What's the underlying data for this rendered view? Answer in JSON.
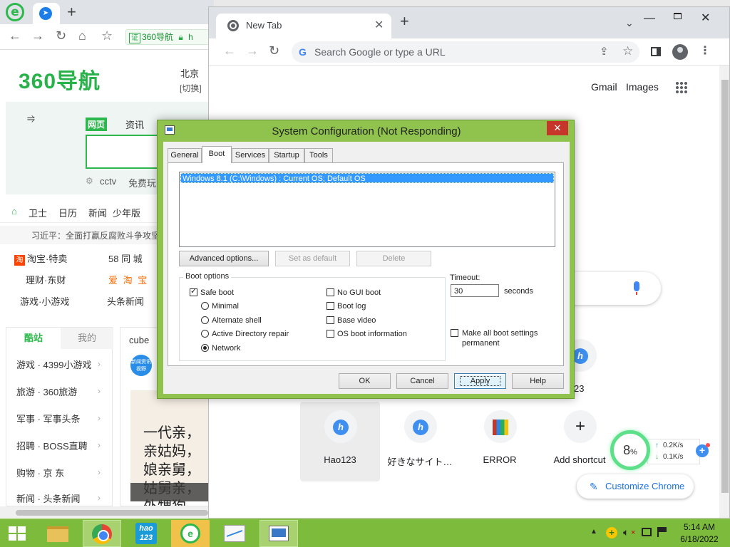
{
  "browser360": {
    "logo_letter": "e",
    "address": {
      "badge": "证",
      "text": "360导航",
      "suffix": "h"
    },
    "site": {
      "logo": "360导航",
      "city": "北京",
      "city_switch": "[切换]",
      "search_tabs": [
        "网页",
        "资讯"
      ],
      "hot_searches": [
        "cctv",
        "免费玩"
      ],
      "quick_links": [
        "卫士",
        "日历",
        "新闻",
        "少年版"
      ],
      "headline": "习近平：全面打赢反腐败斗争攻坚",
      "links": [
        {
          "text": "淘宝·特卖",
          "badge": "淘"
        },
        {
          "text": "58 同 城"
        },
        {
          "text": "理财·东财"
        },
        {
          "text": "爱 淘 宝"
        },
        {
          "text": "游戏·小游戏"
        },
        {
          "text": "头条新闻"
        }
      ],
      "side_tabs": [
        "酷站",
        "我的"
      ],
      "side_items": [
        "游戏 · 4399小游戏",
        "旅游 · 360旅游",
        "军事 · 军事头条",
        "招聘 · BOSS直聘",
        "购物 · 京 东",
        "新闻 · 头条新闻"
      ],
      "card": {
        "title": "cube",
        "avatar_text": "新闻资讯 视野",
        "poem_lines": "一代亲，\n亲姑妈，\n娘亲舅，\n姑舅亲，\n外甥狗"
      }
    }
  },
  "chrome": {
    "tab_title": "New Tab",
    "omnibox_placeholder": "Search Google or type a URL",
    "header_links": [
      "Gmail",
      "Images"
    ],
    "shortcuts": [
      {
        "label": "Hao123",
        "icon": "hao123-icon"
      },
      {
        "label": "好きなサイト…",
        "icon": "hao123-icon"
      },
      {
        "label": "ERROR",
        "icon": "winrar-icon"
      },
      {
        "label": "Add shortcut",
        "icon": "plus-icon"
      }
    ],
    "partial_shortcut_label": "o123",
    "customize_label": "Customize Chrome"
  },
  "speed_widget": {
    "percent": "8",
    "percent_unit": "%",
    "up": "0.2K/s",
    "down": "0.1K/s"
  },
  "msconfig": {
    "title": "System Configuration (Not Responding)",
    "tabs": [
      "General",
      "Boot",
      "Services",
      "Startup",
      "Tools"
    ],
    "active_tab": "Boot",
    "os_entry": "Windows 8.1 (C:\\Windows) : Current OS; Default OS",
    "buttons": {
      "advanced": "Advanced options...",
      "set_default": "Set as default",
      "delete": "Delete"
    },
    "boot_options_label": "Boot options",
    "safe_boot": {
      "label": "Safe boot",
      "checked": true
    },
    "safe_modes": [
      {
        "label": "Minimal",
        "selected": false
      },
      {
        "label": "Alternate shell",
        "selected": false
      },
      {
        "label": "Active Directory repair",
        "selected": false
      },
      {
        "label": "Network",
        "selected": true
      }
    ],
    "right_options": [
      {
        "label": "No GUI boot",
        "checked": false
      },
      {
        "label": "Boot log",
        "checked": false
      },
      {
        "label": "Base video",
        "checked": false
      },
      {
        "label": "OS boot information",
        "checked": false
      }
    ],
    "timeout_label": "Timeout:",
    "timeout_value": "30",
    "timeout_unit": "seconds",
    "make_permanent": {
      "label": "Make all boot settings permanent",
      "checked": false
    },
    "footer_buttons": {
      "ok": "OK",
      "cancel": "Cancel",
      "apply": "Apply",
      "help": "Help"
    }
  },
  "taskbar": {
    "hao_label": "hao 123",
    "time": "5:14 AM",
    "date": "6/18/2022"
  }
}
